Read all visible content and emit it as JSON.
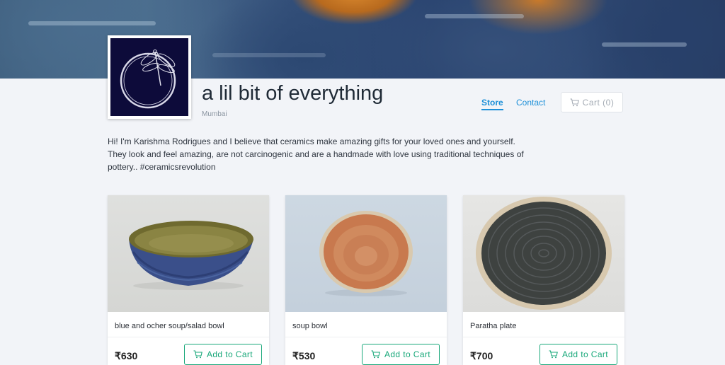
{
  "store": {
    "title": "a lil bit of everything",
    "location": "Mumbai",
    "description": "Hi! I'm Karishma Rodrigues and I believe that ceramics make amazing gifts for your loved ones and yourself. They look and feel amazing, are not carcinogenic and are a handmade with love using traditional techniques of pottery.. #ceramicsrevolution"
  },
  "nav": {
    "store_label": "Store",
    "contact_label": "Contact",
    "cart_label": "Cart (0)"
  },
  "colors": {
    "accent_blue": "#1e90d8",
    "accent_green": "#19a87a",
    "logo_background": "#0d0b3a"
  },
  "products": [
    {
      "name": "blue and ocher soup/salad bowl",
      "price": "₹630",
      "button_label": "Add to Cart"
    },
    {
      "name": "soup bowl",
      "price": "₹530",
      "button_label": "Add to Cart"
    },
    {
      "name": "Paratha plate",
      "price": "₹700",
      "button_label": "Add to Cart"
    }
  ],
  "icons": {
    "cart": "cart-icon",
    "logo": "dragonfly-logo-icon"
  }
}
